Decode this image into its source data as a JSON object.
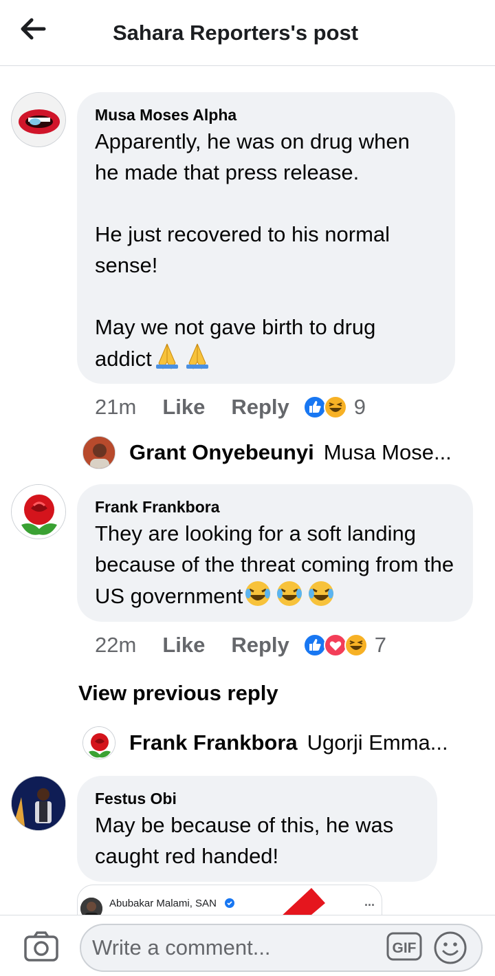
{
  "header": {
    "title": "Sahara Reporters's post"
  },
  "comments": [
    {
      "author": "Musa Moses Alpha",
      "text": "Apparently, he was on drug when he made that press release.\n\nHe just recovered to his normal sense!\n\nMay we not gave birth to drug addict",
      "emoji": "folded-hands x2",
      "time": "21m",
      "like": "Like",
      "reply": "Reply",
      "reactions": [
        "like",
        "haha"
      ],
      "reaction_count": "9",
      "reply_preview": {
        "author": "Grant Onyebeunyi",
        "text": "Musa Mose..."
      }
    },
    {
      "author": "Frank Frankbora",
      "text": "They are looking for a soft landing because of the threat coming from the US government",
      "emoji": "joy x3",
      "time": "22m",
      "like": "Like",
      "reply": "Reply",
      "reactions": [
        "like",
        "love",
        "haha"
      ],
      "reaction_count": "7",
      "view_previous": "View previous reply",
      "reply_preview": {
        "author": "Frank Frankbora",
        "text": "Ugorji Emma..."
      }
    },
    {
      "author": "Festus Obi",
      "text": "May be because of this, he was caught red handed!",
      "attachment": {
        "name": "Abubakar Malami, SAN",
        "menu": "..."
      }
    }
  ],
  "composer": {
    "placeholder": "Write a comment...",
    "gif_label": "GIF"
  },
  "colors": {
    "like_blue": "#1877f2",
    "love_red": "#f33e58",
    "haha_yellow": "#f7b125",
    "bubble_bg": "#f0f2f5",
    "meta_gray": "#65676b"
  }
}
